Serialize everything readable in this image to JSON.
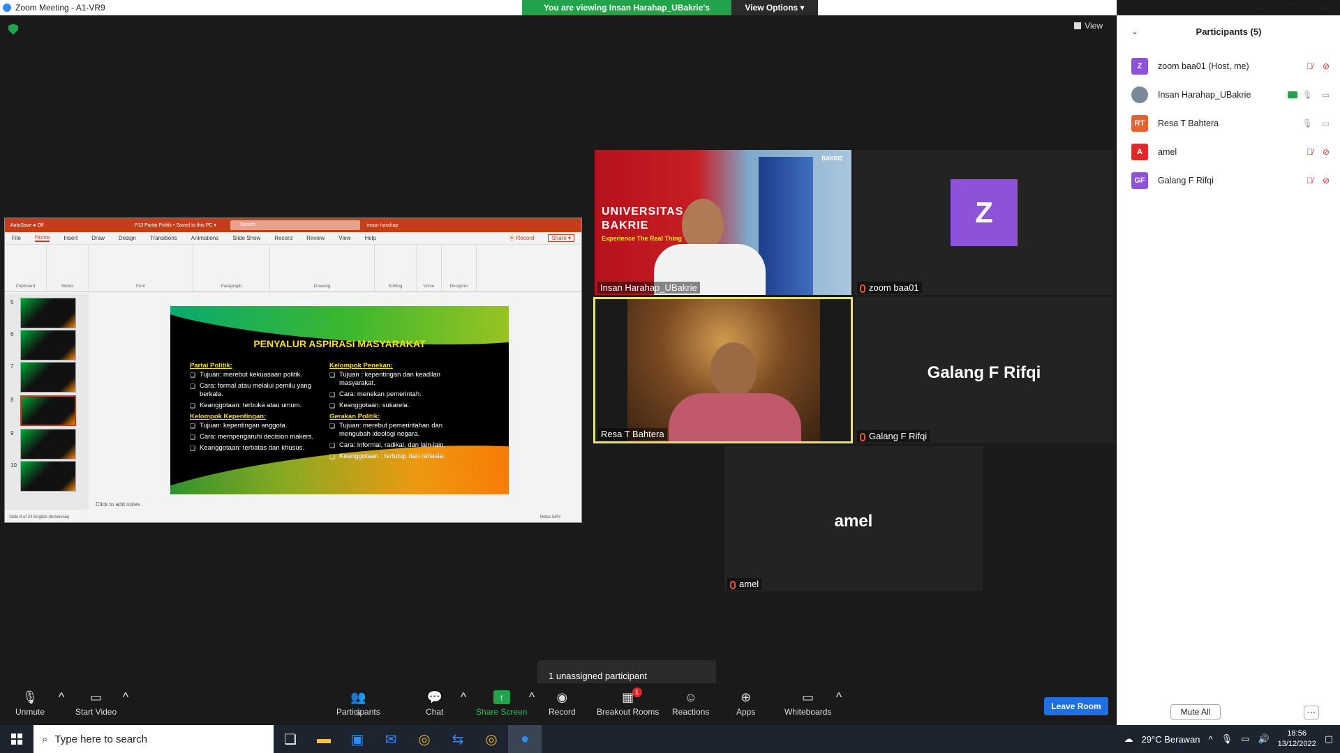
{
  "window": {
    "title": "Zoom Meeting - A1-VR9",
    "minimize": "—",
    "maximize": "❐",
    "close": "✕"
  },
  "banner": {
    "viewing": "You are viewing Insan Harahap_UBakrie's screen",
    "view_options": "View Options ▾"
  },
  "stage": {
    "view_label": "View"
  },
  "ppt": {
    "autosave": "AutoSave ● Off",
    "doc_title": "P13 Partai Politik • Saved to this PC ▾",
    "search": "Search",
    "user": "insan harahap",
    "tabs": [
      "File",
      "Home",
      "Insert",
      "Draw",
      "Design",
      "Transitions",
      "Animations",
      "Slide Show",
      "Record",
      "Review",
      "View",
      "Help"
    ],
    "record": "⦿ Record",
    "share": "Share ▾",
    "groups": [
      "Clipboard",
      "Slides",
      "Font",
      "Paragraph",
      "Drawing",
      "Editing",
      "Voice",
      "Designer"
    ],
    "thumb_numbers": [
      "5",
      "6",
      "7",
      "8",
      "9",
      "10"
    ],
    "notes": "Click to add notes",
    "status_left": "Slide 8 of 24    English (Indonesia)",
    "status_right": "Notes    59%",
    "slide": {
      "title": "PENYALUR ASPIRASI MASYARAKAT",
      "left_col": [
        {
          "heading": "Partai Politik:",
          "items": [
            "Tujuan: merebut kekuasaan politik.",
            "Cara: formal atau melalui pemilu yang berkala.",
            "Keanggotaan: terbuka atau umum."
          ]
        },
        {
          "heading": "Kelompok Kepentingan:",
          "items": [
            "Tujuan: kepentingan anggota.",
            "Cara: mempengaruhi decision makers.",
            "Keanggotaan: terbatas dan khusus."
          ]
        }
      ],
      "right_col": [
        {
          "heading": "Kelompok Penekan:",
          "items": [
            "Tujuan : kepentingan dan keadilan masyarakat.",
            "Cara: menekan pemerintah.",
            "Keanggotaan: sukarela."
          ]
        },
        {
          "heading": "Gerakan Politik:",
          "items": [
            "Tujuan: merebut pemerintahan dan mengubah ideologi negara.",
            "Cara: informal, radikal, dan lain-lain.",
            "Keanggotaan : tertutup dan rahasia."
          ]
        }
      ]
    }
  },
  "tiles": {
    "insan": {
      "name": "Insan Harahap_UBakrie",
      "uni_line1": "UNIVERSITAS",
      "uni_line2": "BAKRIE",
      "tagline": "Experience The Real Thing",
      "logo": "BAKRIE"
    },
    "zoom": {
      "name": "zoom baa01",
      "avatar": "Z"
    },
    "resa": {
      "name": "Resa T Bahtera"
    },
    "galang": {
      "name": "Galang F Rifqi",
      "big": "Galang F Rifqi"
    },
    "amel": {
      "name": "amel",
      "big": "amel"
    }
  },
  "unassigned": "1 unassigned participant",
  "toolbar": {
    "unmute": "Unmute",
    "start_video": "Start Video",
    "participants": "Participants",
    "participants_count": "5",
    "chat": "Chat",
    "share_screen": "Share Screen",
    "record": "Record",
    "breakout": "Breakout Rooms",
    "breakout_badge": "1",
    "reactions": "Reactions",
    "apps": "Apps",
    "whiteboards": "Whiteboards",
    "leave": "Leave Room"
  },
  "panel": {
    "title": "Participants (5)",
    "participants": [
      {
        "initials": "Z",
        "name": "zoom baa01 (Host, me)",
        "color": "#8e52d9",
        "mic": "muted",
        "video": "off"
      },
      {
        "initials": "",
        "name": "Insan Harahap_UBakrie",
        "color": "#7a8a99",
        "mic": "on",
        "video": "on",
        "sharing": true
      },
      {
        "initials": "RT",
        "name": "Resa T Bahtera",
        "color": "#e8612c",
        "mic": "on",
        "video": "on"
      },
      {
        "initials": "A",
        "name": "amel",
        "color": "#e02828",
        "mic": "muted",
        "video": "off"
      },
      {
        "initials": "GF",
        "name": "Galang F Rifqi",
        "color": "#8e52d9",
        "mic": "muted",
        "video": "off"
      }
    ],
    "mute_all": "Mute All",
    "more": "···"
  },
  "taskbar": {
    "search_placeholder": "Type here to search",
    "weather": "29°C  Berawan",
    "time": "18:56",
    "date": "13/12/2022"
  }
}
